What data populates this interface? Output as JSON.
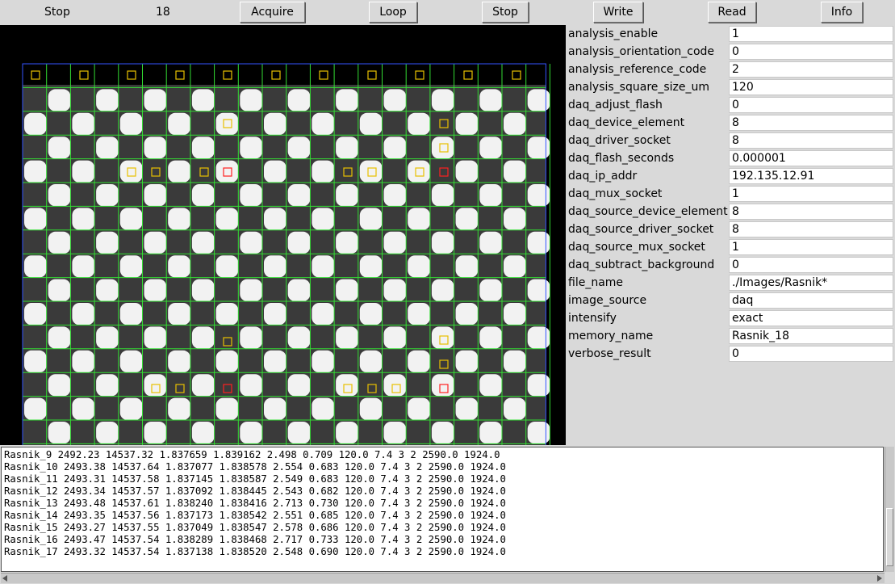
{
  "toolbar": {
    "stop_left_label": "Stop",
    "counter": "18",
    "acquire_label": "Acquire",
    "loop_label": "Loop",
    "stop_label": "Stop",
    "write_label": "Write",
    "read_label": "Read",
    "info_label": "Info"
  },
  "params": [
    {
      "name": "analysis_enable",
      "value": "1"
    },
    {
      "name": "analysis_orientation_code",
      "value": "0"
    },
    {
      "name": "analysis_reference_code",
      "value": "2"
    },
    {
      "name": "analysis_square_size_um",
      "value": "120"
    },
    {
      "name": "daq_adjust_flash",
      "value": "0"
    },
    {
      "name": "daq_device_element",
      "value": "8"
    },
    {
      "name": "daq_driver_socket",
      "value": "8"
    },
    {
      "name": "daq_flash_seconds",
      "value": "0.000001"
    },
    {
      "name": "daq_ip_addr",
      "value": "192.135.12.91"
    },
    {
      "name": "daq_mux_socket",
      "value": "1"
    },
    {
      "name": "daq_source_device_element",
      "value": "8"
    },
    {
      "name": "daq_source_driver_socket",
      "value": "8"
    },
    {
      "name": "daq_source_mux_socket",
      "value": "1"
    },
    {
      "name": "daq_subtract_background",
      "value": "0"
    },
    {
      "name": "file_name",
      "value": "./Images/Rasnik*"
    },
    {
      "name": "image_source",
      "value": "daq"
    },
    {
      "name": "intensify",
      "value": "exact"
    },
    {
      "name": "memory_name",
      "value": "Rasnik_18"
    },
    {
      "name": "verbose_result",
      "value": "0"
    }
  ],
  "results": [
    "Rasnik_9 2492.23 14537.32 1.837659 1.839162 2.498 0.709 120.0 7.4 3 2 2590.0 1924.0",
    "Rasnik_10 2493.38 14537.64 1.837077 1.838578 2.554 0.683 120.0 7.4 3 2 2590.0 1924.0",
    "Rasnik_11 2493.31 14537.58 1.837145 1.838587 2.549 0.683 120.0 7.4 3 2 2590.0 1924.0",
    "Rasnik_12 2493.34 14537.57 1.837092 1.838445 2.543 0.682 120.0 7.4 3 2 2590.0 1924.0",
    "Rasnik_13 2493.48 14537.61 1.838240 1.838416 2.713 0.730 120.0 7.4 3 2 2590.0 1924.0",
    "Rasnik_14 2493.35 14537.56 1.837173 1.838542 2.551 0.685 120.0 7.4 3 2 2590.0 1924.0",
    "Rasnik_15 2493.27 14537.55 1.837049 1.838547 2.578 0.686 120.0 7.4 3 2 2590.0 1924.0",
    "Rasnik_16 2493.47 14537.54 1.838289 1.838468 2.717 0.733 120.0 7.4 3 2 2590.0 1924.0",
    "Rasnik_17 2493.32 14537.54 1.837138 1.838520 2.548 0.690 120.0 7.4 3 2 2590.0 1924.0"
  ],
  "colors": {
    "grid": "#33dd33",
    "code_box": "#e8c000",
    "ref_box": "#ff2020",
    "bounds": "#3355ff"
  }
}
